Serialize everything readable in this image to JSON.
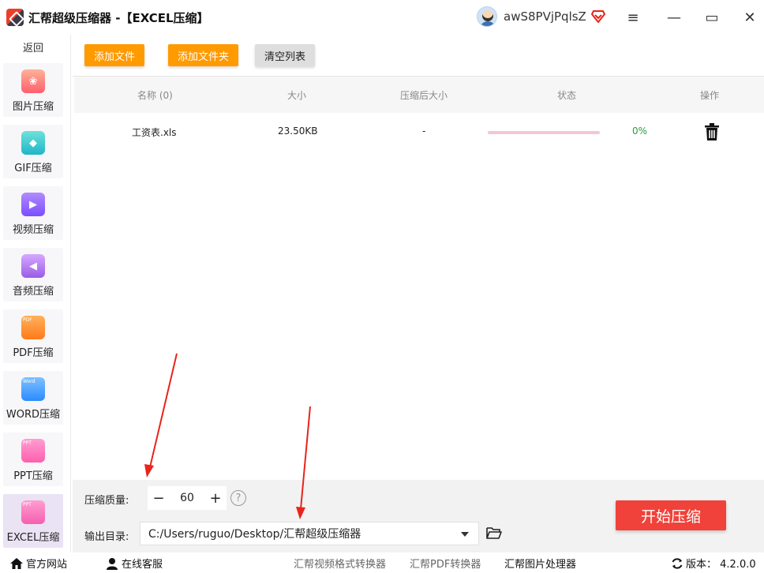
{
  "titlebar": {
    "app_name": "汇帮超级压缩器",
    "mode": " -【EXCEL压缩】",
    "username": "awS8PVjPqlsZ",
    "menu_glyph": "≡",
    "min_glyph": "—",
    "max_glyph": "▭",
    "close_glyph": "✕"
  },
  "sidebar": {
    "back_label": "返回",
    "items": [
      {
        "label": "图片压缩",
        "icon": "image-icon"
      },
      {
        "label": "GIF压缩",
        "icon": "gif-icon"
      },
      {
        "label": "视频压缩",
        "icon": "video-icon"
      },
      {
        "label": "音频压缩",
        "icon": "audio-icon"
      },
      {
        "label": "PDF压缩",
        "icon": "pdf-icon",
        "tag": "PDF"
      },
      {
        "label": "WORD压缩",
        "icon": "word-icon",
        "tag": "Word"
      },
      {
        "label": "PPT压缩",
        "icon": "ppt-icon",
        "tag": "PPT"
      },
      {
        "label": "EXCEL压缩",
        "icon": "excel-icon",
        "tag": "PPT",
        "active": true
      }
    ]
  },
  "toolbar": {
    "add_file": "添加文件",
    "add_folder": "添加文件夹",
    "clear_list": "清空列表"
  },
  "table": {
    "headers": {
      "name": "名称 (0)",
      "size": "大小",
      "compressed_size": "压缩后大小",
      "status": "状态",
      "actions": "操作"
    },
    "rows": [
      {
        "name": "工资表.xls",
        "size": "23.50KB",
        "compressed_size": "-",
        "progress_percent": 0,
        "progress_label": "0%"
      }
    ]
  },
  "settings": {
    "quality_label": "压缩质量:",
    "quality_value": "60",
    "minus": "−",
    "plus": "+",
    "help": "?",
    "output_label": "输出目录:",
    "output_path": "C:/Users/ruguo/Desktop/汇帮超级压缩器",
    "start_label": "开始压缩"
  },
  "statusbar": {
    "site": "官方网站",
    "service": "在线客服",
    "video_tool": "汇帮视频格式转换器",
    "pdf_tool": "汇帮PDF转换器",
    "image_tool": "汇帮图片处理器",
    "version": "版本： 4.2.0.0"
  },
  "colors": {
    "accent_orange": "#ff9a00",
    "start_red": "#f0423a",
    "progress_done": "#2a9d3a",
    "arrow_red": "#e8241c"
  }
}
